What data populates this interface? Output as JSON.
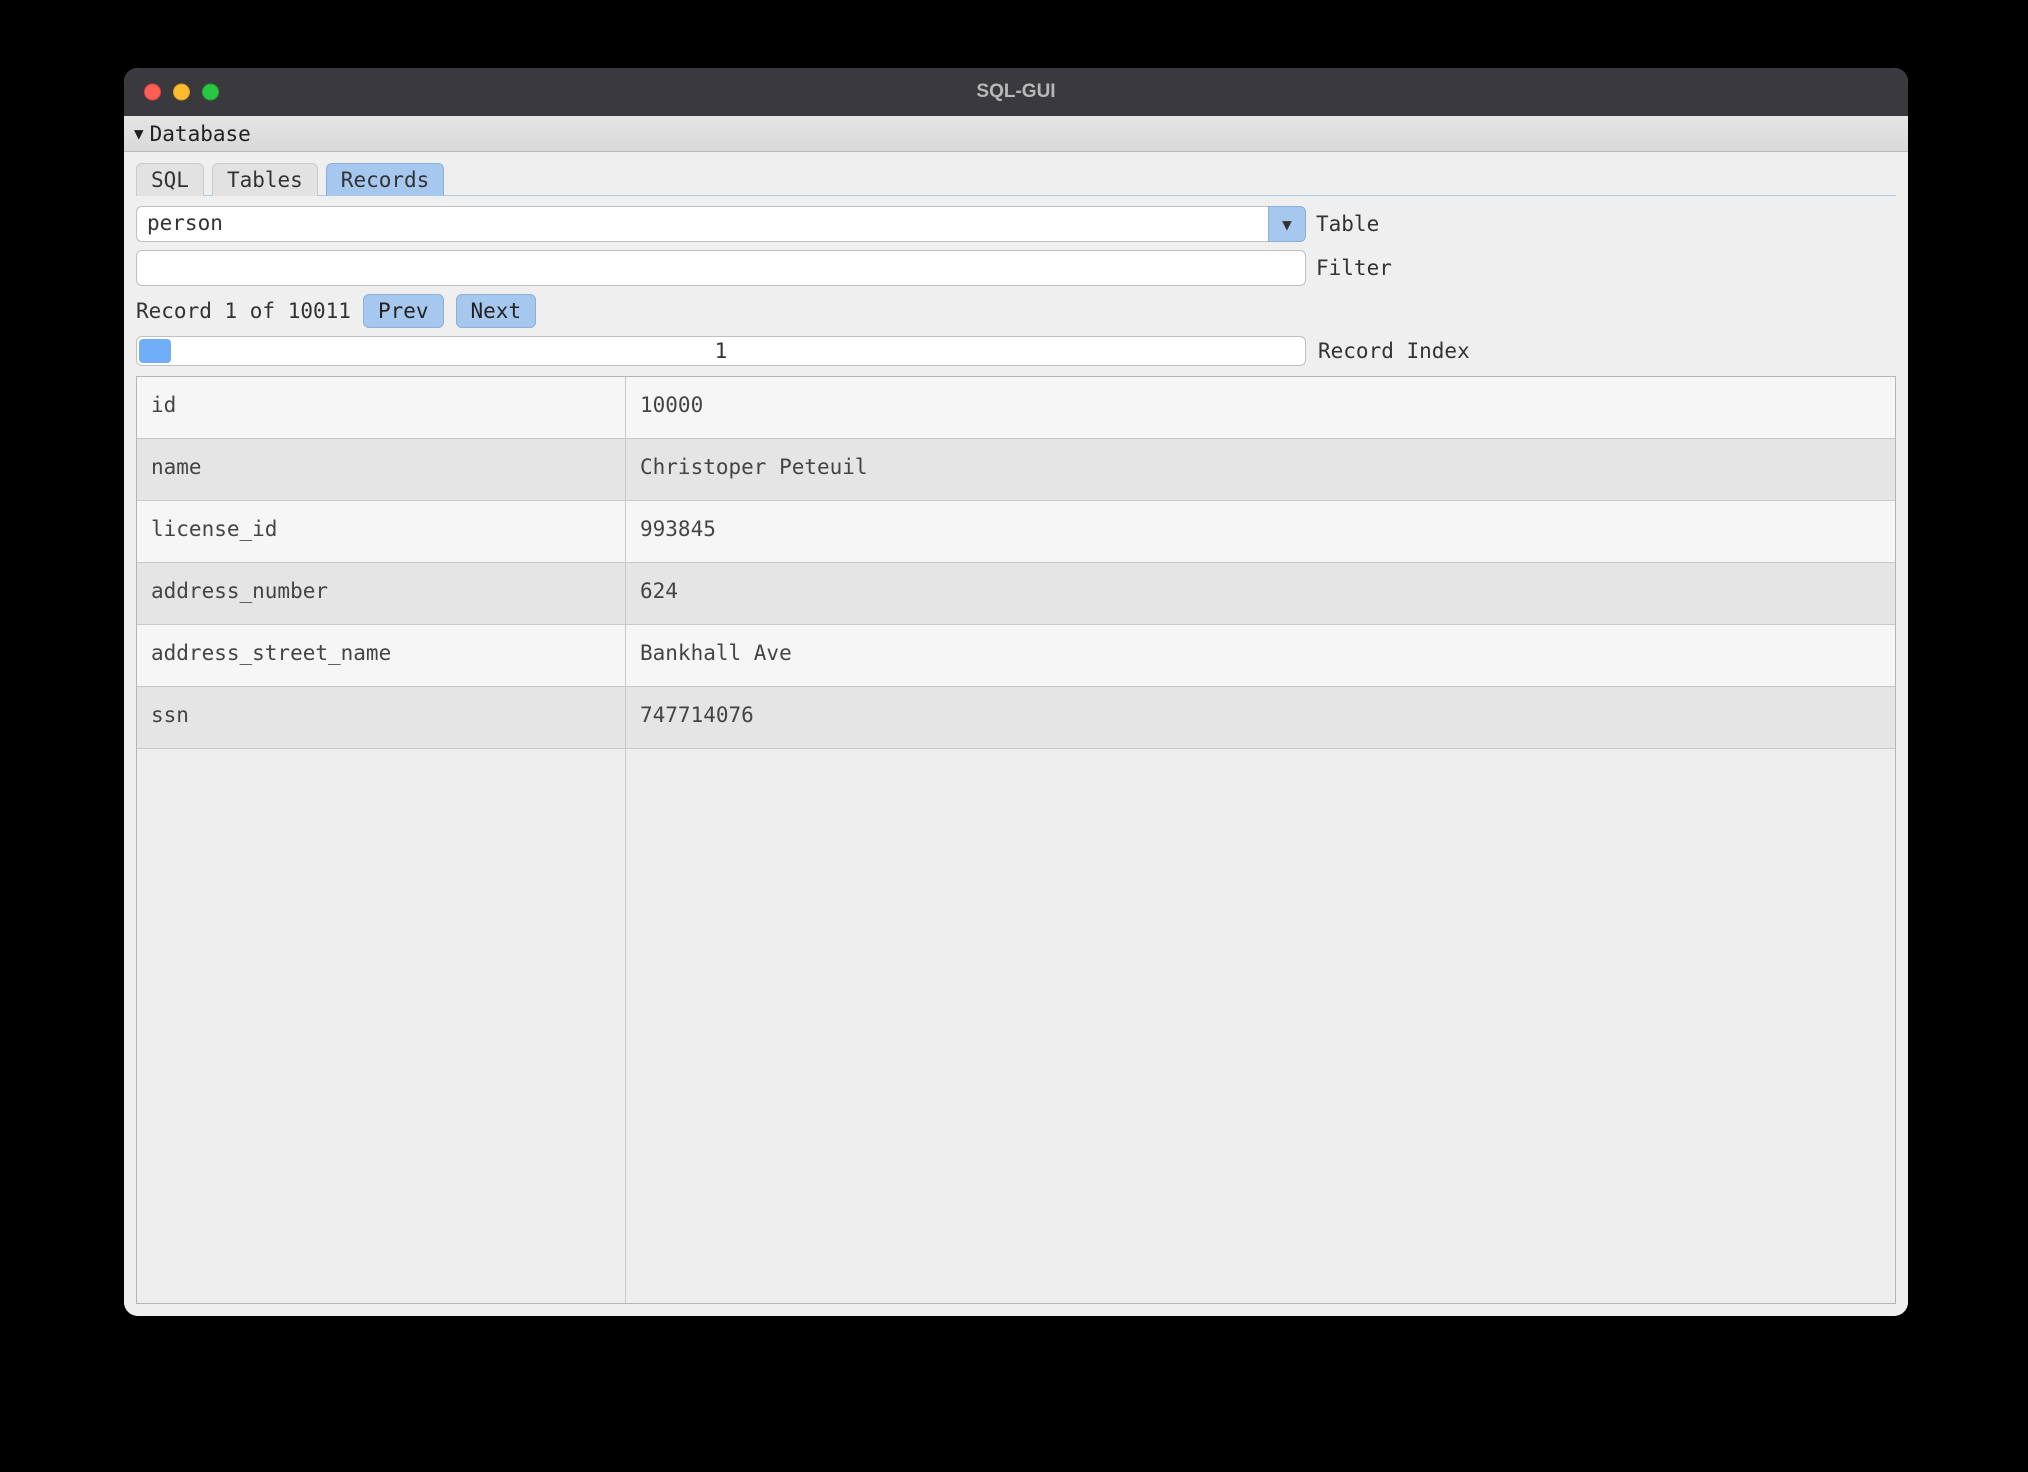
{
  "window": {
    "title": "SQL-GUI"
  },
  "menubar": {
    "database_label": "Database"
  },
  "tabs": {
    "sql": "SQL",
    "tables": "Tables",
    "records": "Records",
    "active": "records"
  },
  "table_select": {
    "value": "person",
    "label": "Table"
  },
  "filter": {
    "value": "",
    "label": "Filter"
  },
  "record_nav": {
    "status": "Record 1 of 10011",
    "prev_label": "Prev",
    "next_label": "Next"
  },
  "slider": {
    "value_display": "1",
    "label": "Record Index"
  },
  "fields": [
    {
      "key": "id",
      "value": "10000"
    },
    {
      "key": "name",
      "value": "Christoper Peteuil"
    },
    {
      "key": "license_id",
      "value": "993845"
    },
    {
      "key": "address_number",
      "value": "624"
    },
    {
      "key": "address_street_name",
      "value": "Bankhall Ave"
    },
    {
      "key": "ssn",
      "value": "747714076"
    }
  ]
}
